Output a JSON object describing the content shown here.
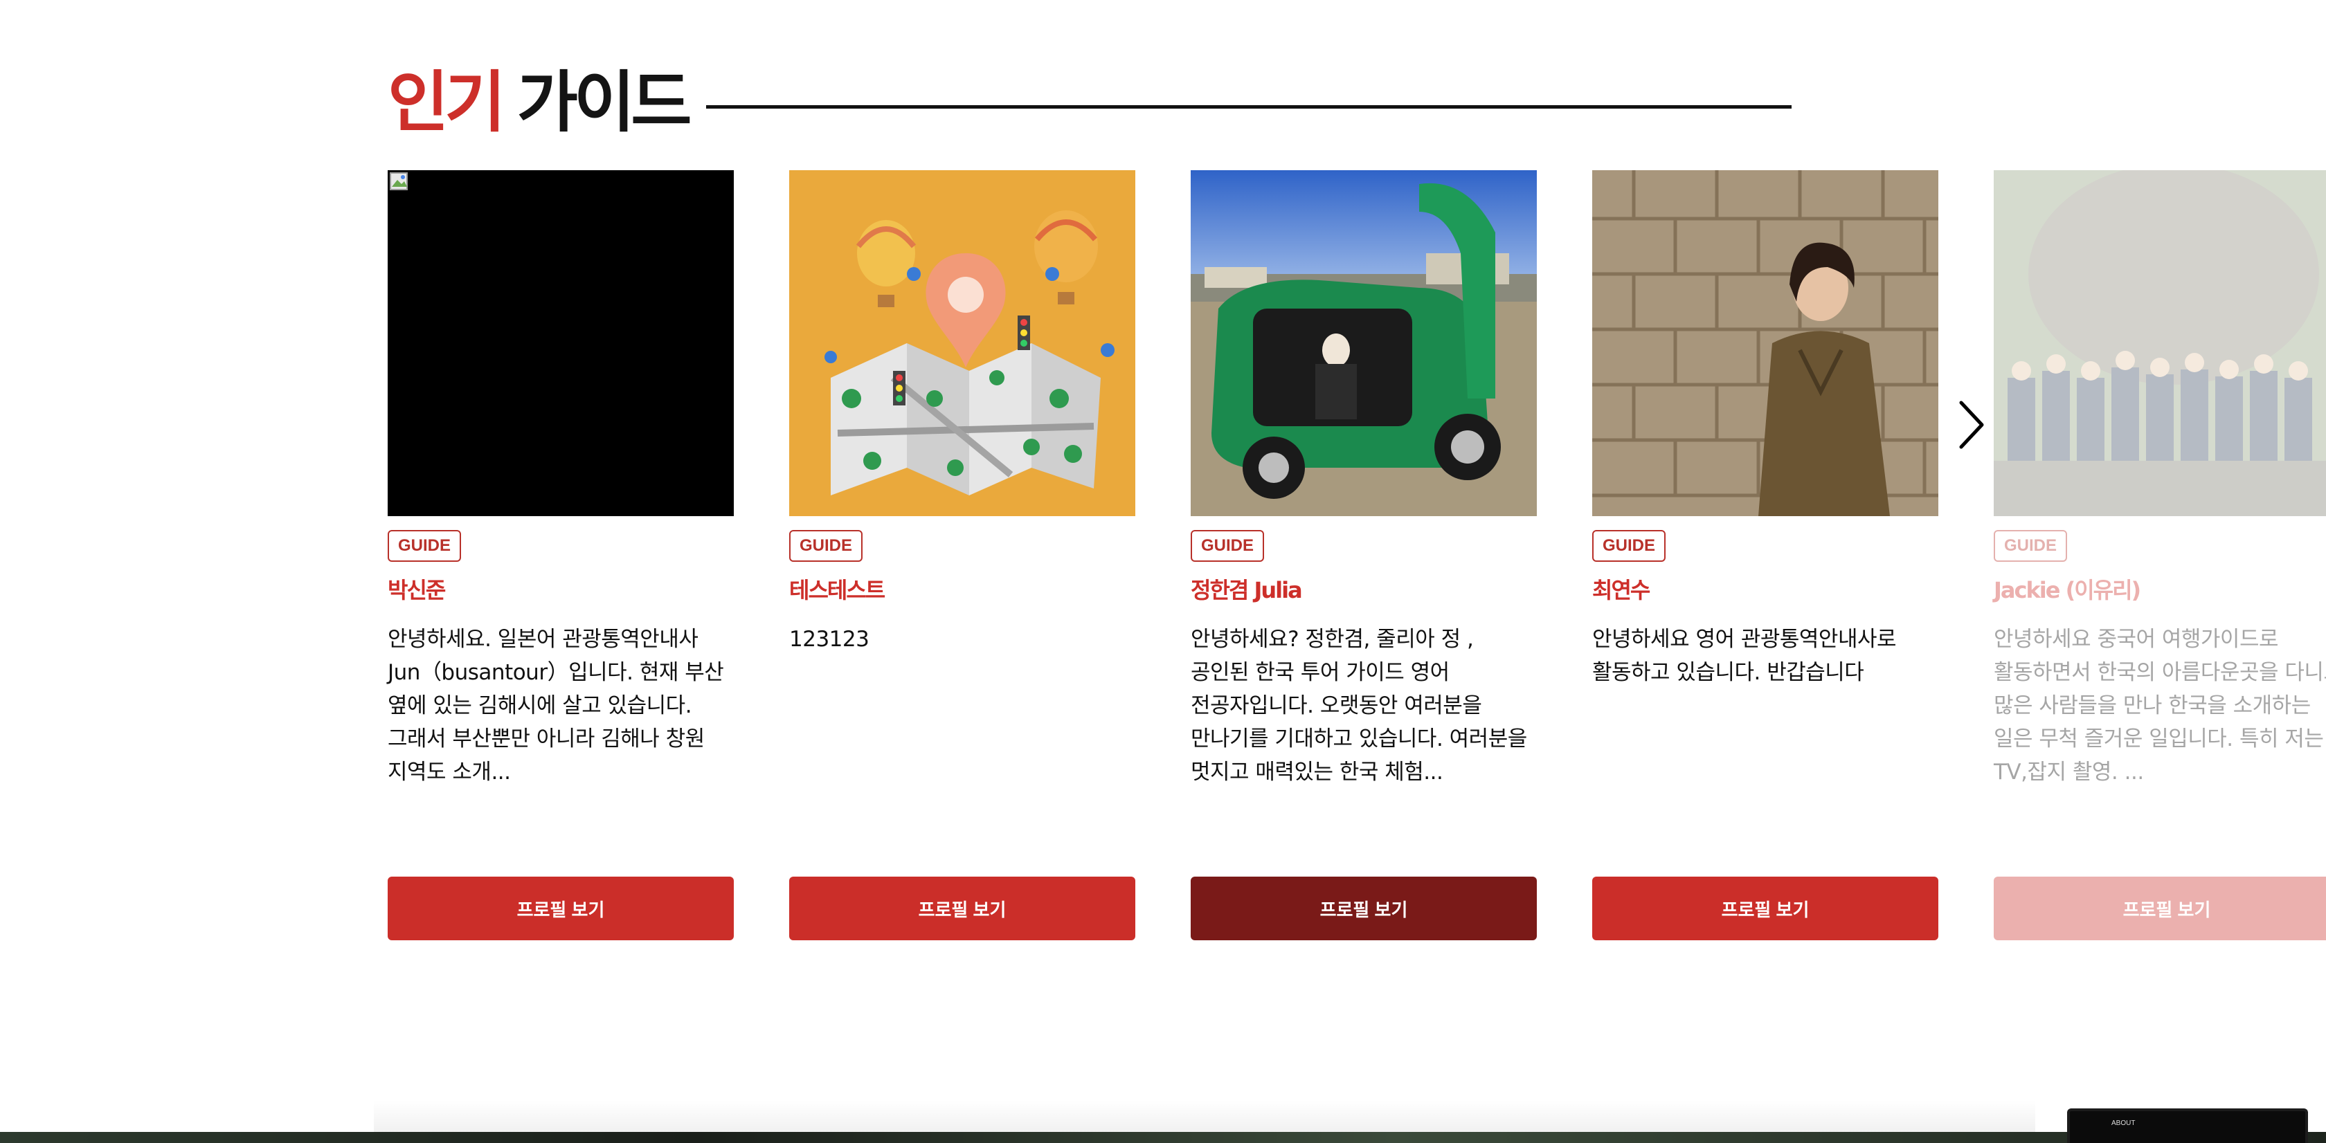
{
  "section": {
    "title_highlight": "인기",
    "title_rest": "가이드"
  },
  "guides": [
    {
      "badge": "GUIDE",
      "name": "박신준",
      "description": "안녕하세요. 일본어 관광통역안내사 Jun（busantour）입니다. 현재 부산 옆에 있는 김해시에 살고 있습니다. 그래서 부산뿐만 아니라 김해나 창원 지역도 소개...",
      "button": "프로필 보기",
      "photo": "broken-image"
    },
    {
      "badge": "GUIDE",
      "name": "테스테스트",
      "description": "123123",
      "button": "프로필 보기",
      "photo": "map-illustration"
    },
    {
      "badge": "GUIDE",
      "name": "정한겸 Julia",
      "description": "안녕하세요? 정한겸, 줄리아 정 , 공인된 한국 투어 가이드 영어 전공자입니다. 오랫동안 여러분을 만나기를 기대하고 있습니다. 여러분을 멋지고 매력있는 한국 체험...",
      "button": "프로필 보기",
      "photo": "green-car"
    },
    {
      "badge": "GUIDE",
      "name": "최연수",
      "description": "안녕하세요 영어 관광통역안내사로 활동하고 있습니다. 반갑습니다",
      "button": "프로필 보기",
      "photo": "woman-stone-wall"
    },
    {
      "badge": "GUIDE",
      "name": "Jackie (이유리)",
      "description": "안녕하세요 중국어 여행가이드로 활동하면서 한국의 아름다운곳을 다니고 많은 사람들을 만나 한국을 소개하는 일은 무척 즐거운 일입니다. 특히 저는 TV,잡지 촬영. ...",
      "button": "프로필 보기",
      "photo": "group-photo"
    }
  ],
  "colors": {
    "accent": "#cb2e29",
    "accent_active": "#7a1a18",
    "badge_border": "#b8312a"
  },
  "footer_thumb_label": "ABOUT"
}
